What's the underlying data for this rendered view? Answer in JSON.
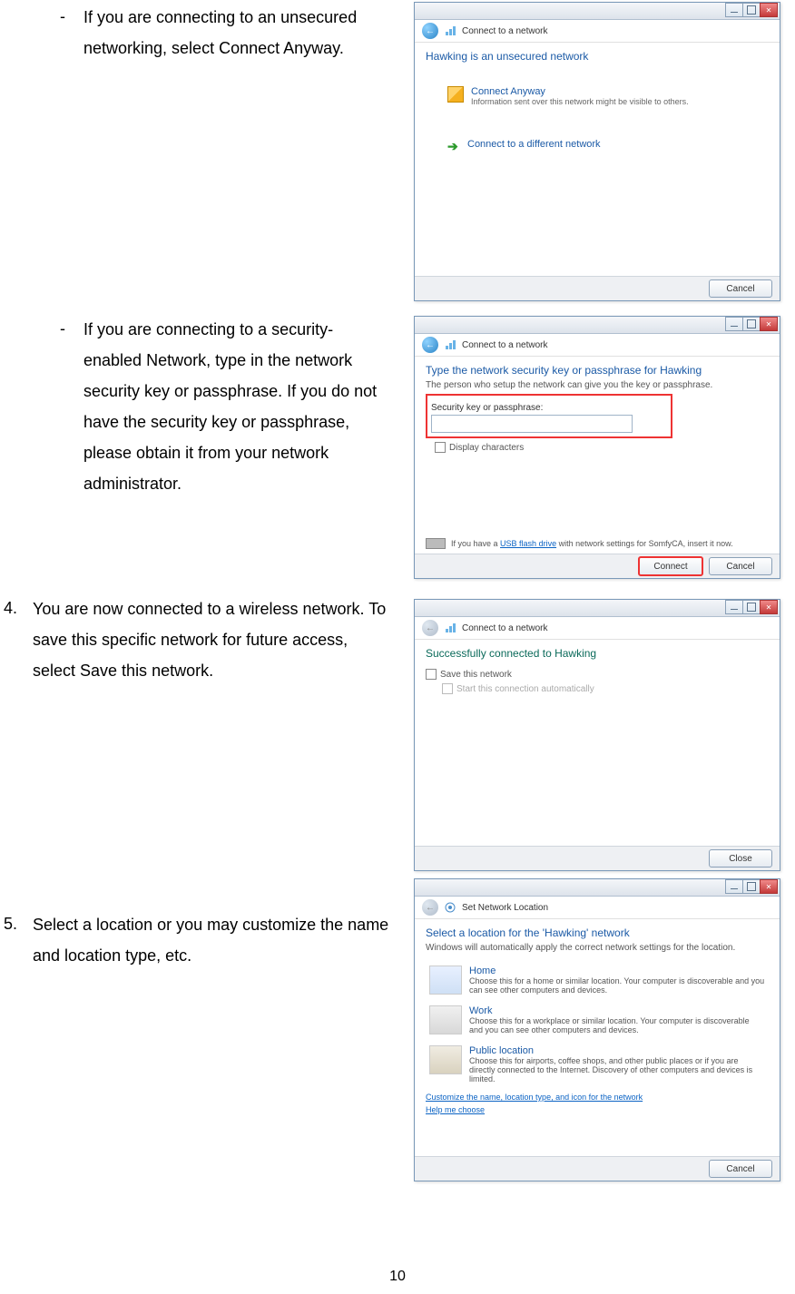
{
  "page_number": "10",
  "instructions": {
    "bullet1": "If you are connecting to an unsecured networking, select Connect Anyway.",
    "bullet2": "If you are connecting to a security-enabled Network, type in the network security key or passphrase. If you do not have the security key or passphrase, please obtain it from your network administrator.",
    "step4_num": "4.",
    "step4": "You are now connected to a wireless network. To save this specific network for future access, select Save this network.",
    "step5_num": "5.",
    "step5": "Select a location or you may customize the name and location type, etc."
  },
  "dialog1": {
    "nav_title": "Connect to a network",
    "heading": "Hawking is an unsecured network",
    "opt1_title": "Connect Anyway",
    "opt1_desc": "Information sent over this network might be visible to others.",
    "opt2_title": "Connect to a different network",
    "cancel": "Cancel"
  },
  "dialog2": {
    "nav_title": "Connect to a network",
    "heading": "Type the network security key or passphrase for Hawking",
    "sub": "The person who setup the network can give you the key or passphrase.",
    "field_label": "Security key or passphrase:",
    "display_chars": "Display characters",
    "usb_pre": "If you have a ",
    "usb_link": "USB flash drive",
    "usb_post": " with network settings for SomfyCA, insert it now.",
    "connect": "Connect",
    "cancel": "Cancel"
  },
  "dialog3": {
    "nav_title": "Connect to a network",
    "heading": "Successfully connected to Hawking",
    "save": "Save this network",
    "auto": "Start this connection automatically",
    "close": "Close"
  },
  "dialog4": {
    "nav_title": "Set Network Location",
    "heading": "Select a location for the 'Hawking' network",
    "sub": "Windows will automatically apply the correct network settings for the location.",
    "home_t": "Home",
    "home_d": "Choose this for a home or similar location. Your computer is discoverable and you can see other computers and devices.",
    "work_t": "Work",
    "work_d": "Choose this for a workplace or similar location. Your computer is discoverable and you can see other computers and devices.",
    "pub_t": "Public location",
    "pub_d": "Choose this for airports, coffee shops, and other public places or if you are directly connected to the Internet. Discovery of other computers and devices is limited.",
    "link1": "Customize the name, location type, and icon for the network",
    "link2": "Help me choose",
    "cancel": "Cancel"
  }
}
